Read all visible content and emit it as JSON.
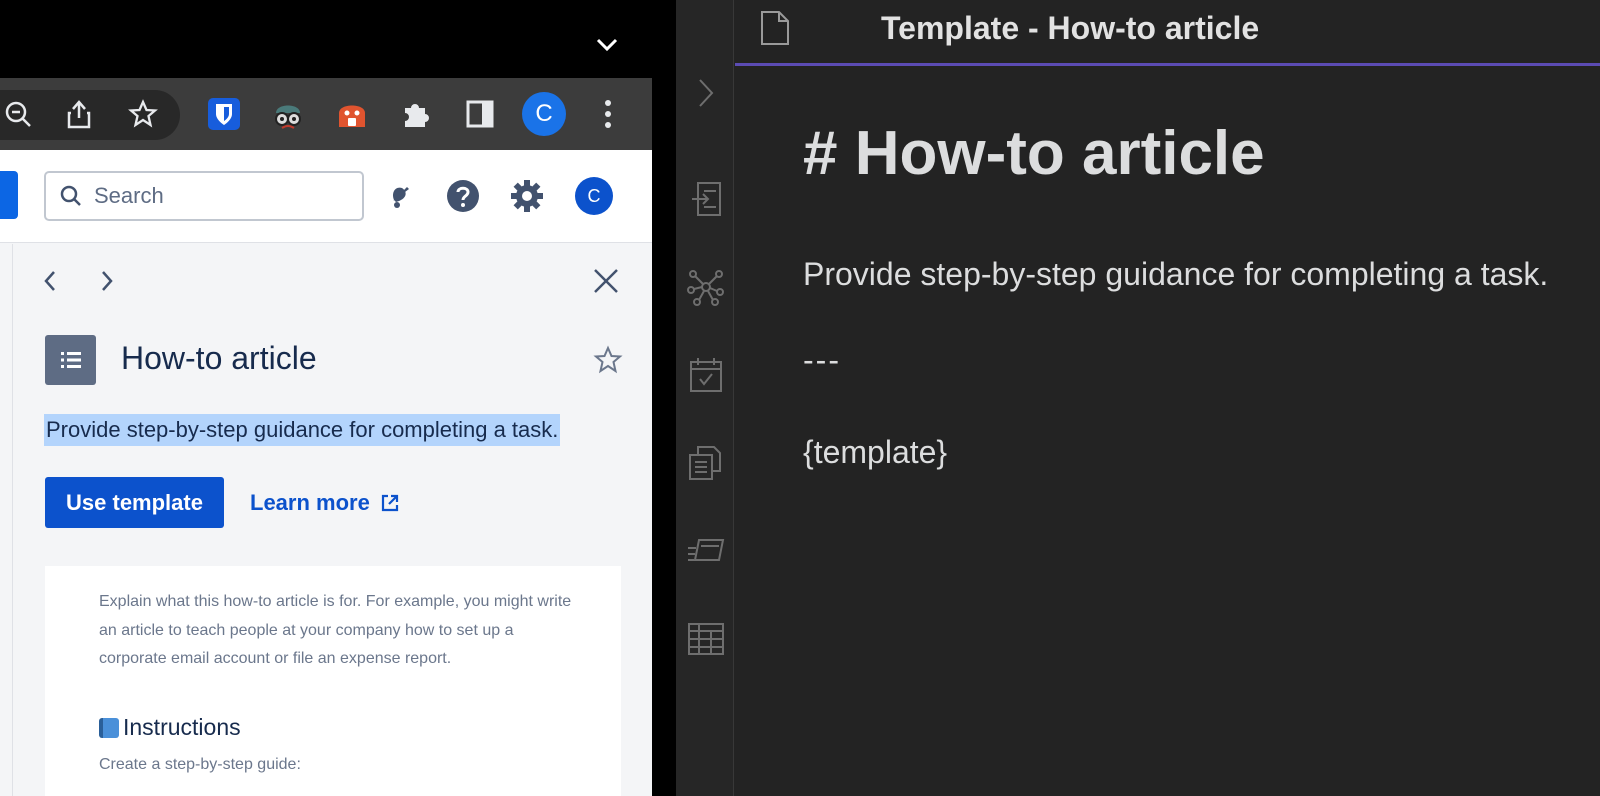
{
  "browser": {
    "toolbar": {
      "icons": [
        "zoom-icon",
        "share-icon",
        "bookmark-star-icon",
        "bitwarden-icon",
        "spy-extension-icon",
        "lock-extension-icon",
        "extensions-puzzle-icon",
        "side-panel-icon",
        "profile-avatar",
        "more-menu-icon"
      ],
      "profile_initial": "C",
      "profile_color": "#1a73e8"
    },
    "confluence_header": {
      "search_placeholder": "Search",
      "avatar_initial": "C",
      "accent": "#0c52cc"
    },
    "template_panel": {
      "title": "How-to article",
      "description": "Provide step-by-step guidance for completing a task.",
      "use_button": "Use template",
      "learn_more": "Learn more",
      "preview": {
        "intro": "Explain what this how-to article is for. For example, you might write an article to teach people at your company how to set up a corporate email account or file an expense report.",
        "heading": "Instructions",
        "sub": "Create a step-by-step guide:"
      }
    }
  },
  "editor": {
    "tab_title": "Template - How-to article",
    "heading": "# How-to article",
    "paragraph": "Provide step-by-step guidance for completing a task.",
    "rule": "---",
    "placeholder": "{template}",
    "ribbon_icons": [
      "collapse-chevron-icon",
      "import-note-icon",
      "graph-view-icon",
      "daily-note-icon",
      "templates-icon",
      "slides-icon",
      "table-icon"
    ],
    "accent": "#5b4bb3"
  }
}
